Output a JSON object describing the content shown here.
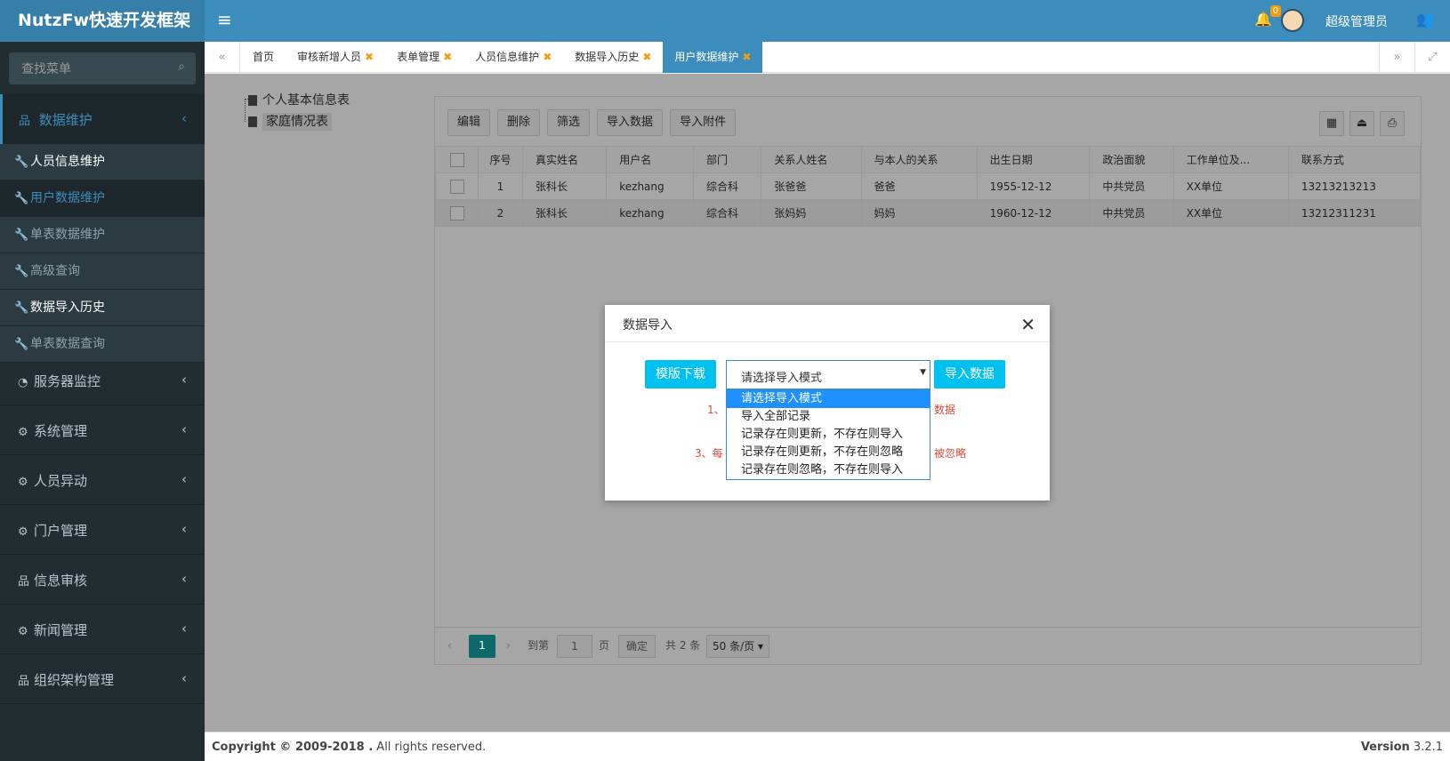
{
  "app": {
    "logo": "NutzFw快速开发框架",
    "notification_count": "0",
    "user_name": "超级管理员"
  },
  "sidebar": {
    "search_placeholder": "查找菜单",
    "active_menu": "数据维护",
    "submenu": [
      "人员信息维护",
      "用户数据维护",
      "单表数据维护",
      "高级查询",
      "数据导入历史",
      "单表数据查询"
    ],
    "menus": [
      "服务器监控",
      "系统管理",
      "人员异动",
      "门户管理",
      "信息审核",
      "新闻管理",
      "组织架构管理"
    ]
  },
  "tabs": [
    "首页",
    "审核新增人员",
    "表单管理",
    "人员信息维护",
    "数据导入历史",
    "用户数据维护"
  ],
  "tree": [
    "个人基本信息表",
    "家庭情况表"
  ],
  "toolbar": [
    "编辑",
    "删除",
    "筛选",
    "导入数据",
    "导入附件"
  ],
  "table": {
    "headers": [
      "序号",
      "真实姓名",
      "用户名",
      "部门",
      "关系人姓名",
      "与本人的关系",
      "出生日期",
      "政治面貌",
      "工作单位及...",
      "联系方式"
    ],
    "rows": [
      [
        "1",
        "张科长",
        "kezhang",
        "综合科",
        "张爸爸",
        "爸爸",
        "1955-12-12",
        "中共党员",
        "XX单位",
        "13213213213"
      ],
      [
        "2",
        "张科长",
        "kezhang",
        "综合科",
        "张妈妈",
        "妈妈",
        "1960-12-12",
        "中共党员",
        "XX单位",
        "13212311231"
      ]
    ]
  },
  "pager": {
    "page": "1",
    "goto_label": "到第",
    "goto_value": "1",
    "page_unit": "页",
    "confirm": "确定",
    "total": "共 2 条",
    "per_page": "50 条/页"
  },
  "modal": {
    "title": "数据导入",
    "download_btn": "模版下载",
    "select_placeholder": "请选择导入模式",
    "import_btn": "导入数据",
    "hint1_a": "1、",
    "hint1_b": "数据",
    "hint3_a": "3、每",
    "hint3_b": "被忽略",
    "options": [
      "请选择导入模式",
      "导入全部记录",
      "记录存在则更新，不存在则导入",
      "记录存在则更新，不存在则忽略",
      "记录存在则忽略，不存在则导入"
    ]
  },
  "footer": {
    "copyright_bold": "Copyright © 2009-2018 .",
    "copyright_rest": " All rights reserved.",
    "version_label": "Version",
    "version": "3.2.1"
  },
  "colors": {
    "header": "#3c8dbc",
    "logo": "#367fa9",
    "sidebar": "#222d32",
    "accent_btn": "#00c0ef",
    "tab_close": "#f39c12",
    "hint": "#dd4b39"
  }
}
